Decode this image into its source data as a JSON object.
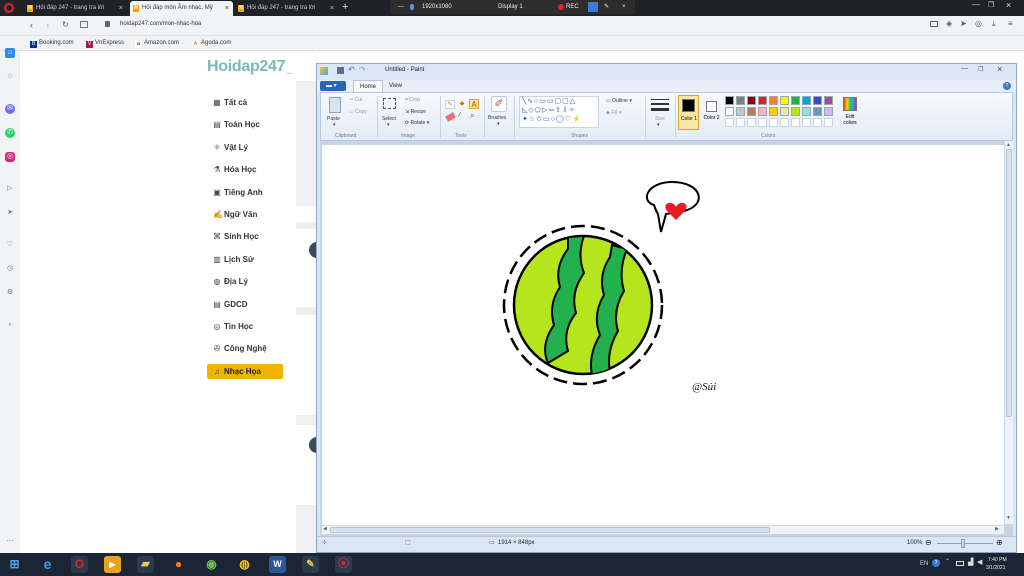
{
  "browser": {
    "tabs": [
      {
        "label": "Hỏi đáp 247 - trang tra lời"
      },
      {
        "label": "Hỏi đáp môn Âm nhạc, Mỹ"
      },
      {
        "label": "Hỏi đáp 247 - trang tra lời"
      }
    ],
    "recorder": {
      "resolution": "1920x1080",
      "display": "Display 1",
      "rec_label": "REC"
    },
    "url": "hoidap247.com/mon-nhac-hoa",
    "bookmarks": [
      "Booking.com",
      "VnExpress",
      "Amazon.com",
      "Agoda.com"
    ]
  },
  "site": {
    "logo_main": "Hoidap247",
    "logo_sub": ".com",
    "nav": [
      {
        "label": "Tất cả",
        "icon": "grid-icon"
      },
      {
        "label": "Toán Học",
        "icon": "calculator-icon"
      },
      {
        "label": "Vật Lý",
        "icon": "atom-icon"
      },
      {
        "label": "Hóa Học",
        "icon": "flask-icon"
      },
      {
        "label": "Tiếng Anh",
        "icon": "translate-icon"
      },
      {
        "label": "Ngữ Văn",
        "icon": "pen-icon"
      },
      {
        "label": "Sinh Học",
        "icon": "dna-icon"
      },
      {
        "label": "Lịch Sử",
        "icon": "book-icon"
      },
      {
        "label": "Địa Lý",
        "icon": "globe-icon"
      },
      {
        "label": "GDCD",
        "icon": "document-icon"
      },
      {
        "label": "Tin Học",
        "icon": "computer-icon"
      },
      {
        "label": "Công Nghệ",
        "icon": "gear-icon"
      },
      {
        "label": "Nhạc Họa",
        "icon": "music-icon",
        "active": true
      }
    ]
  },
  "paint": {
    "title": "Untitled - Paint",
    "tabs": [
      "Home",
      "View"
    ],
    "clipboard": {
      "paste": "Paste",
      "cut": "Cut",
      "copy": "Copy",
      "label": "Clipboard"
    },
    "image": {
      "select": "Select",
      "crop": "Crop",
      "resize": "Resize",
      "rotate": "Rotate",
      "label": "Image"
    },
    "tools_label": "Tools",
    "brushes": "Brushes",
    "shapes": {
      "outline": "Outline",
      "fill": "Fill",
      "label": "Shapes"
    },
    "size": "Size",
    "color1": "Color 1",
    "color2": "Color 2",
    "edit_colors": "Edit colors",
    "colors_label": "Colors",
    "palette": [
      "#000000",
      "#7f7f7f",
      "#880015",
      "#ed1c24",
      "#ff7f27",
      "#fff200",
      "#22b14c",
      "#00a2e8",
      "#3f48cc",
      "#a349a4",
      "#ffffff",
      "#c3c3c3",
      "#b97a57",
      "#ffaec9",
      "#ffc90e",
      "#efe4b0",
      "#b5e61d",
      "#99d9ea",
      "#7092be",
      "#c8bfe7"
    ],
    "canvas_signature": "@Sủi",
    "status_size": "1914 × 848px",
    "zoom": "100%"
  },
  "taskbar": {
    "lang": "EN",
    "time": "7:40 PM",
    "date": "3/1/2021"
  }
}
